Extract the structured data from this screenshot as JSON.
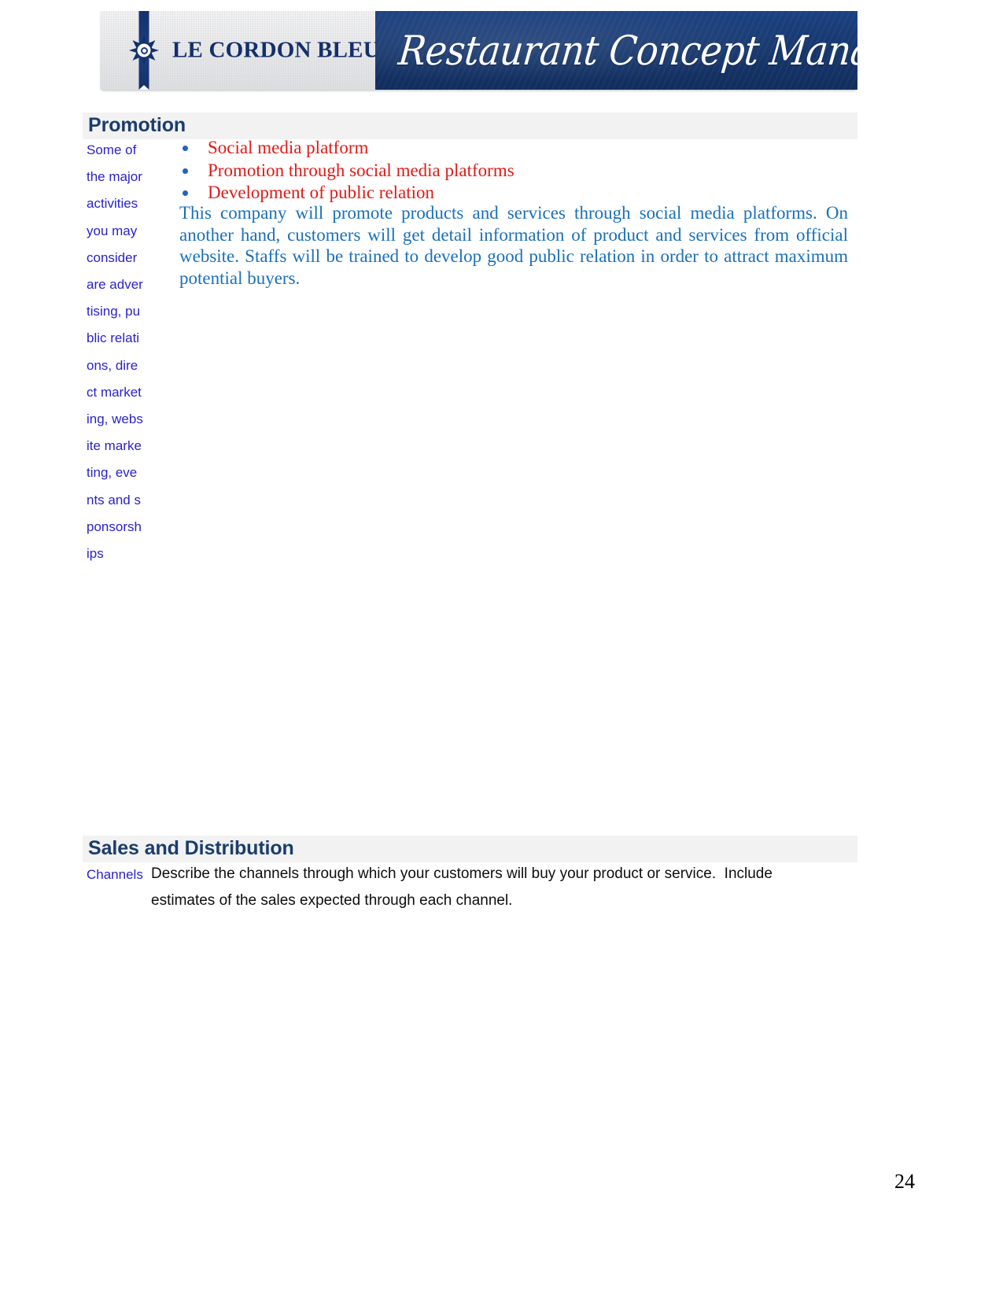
{
  "document": {
    "page_number": "24"
  },
  "banner": {
    "brand_name": "LE CORDON BLEU",
    "registered_mark": "®",
    "title_script": "Restaurant Concept Management",
    "crest_icon": "cordon-bleu-crest-icon",
    "colors": {
      "navy": "#15306b",
      "banner_navy": "#17386f",
      "plate_light": "#ececec"
    }
  },
  "sections": {
    "promotion": {
      "heading": "Promotion",
      "sidebar_note": "Some of the major activities you may consider are advertising, public relations, direct marketing, website marketing, events and sponsorships",
      "bullets": [
        "Social media platform",
        "Promotion through social media platforms",
        "Development of public relation"
      ],
      "paragraph": "This company will promote products and services through social media platforms. On another hand, customers will get detail information of product and services from official website. Staffs will be trained to develop good public relation in order to attract maximum potential buyers."
    },
    "sales_and_distribution": {
      "heading": "Sales and Distribution",
      "sidebar_note": "Channels",
      "description": "Describe the channels through which your customers will buy your product or service.  Include estimates of the sales expected through each channel."
    }
  },
  "colors": {
    "heading_navy": "#1a3d6d",
    "heading_band": "#f2f2f2",
    "sidebar_blue": "#2a22cc",
    "bullet_red": "#e01b17",
    "bullet_marker_blue": "#1f63c4",
    "paragraph_blue": "#1a70b8",
    "body_black": "#0d0d0d"
  }
}
